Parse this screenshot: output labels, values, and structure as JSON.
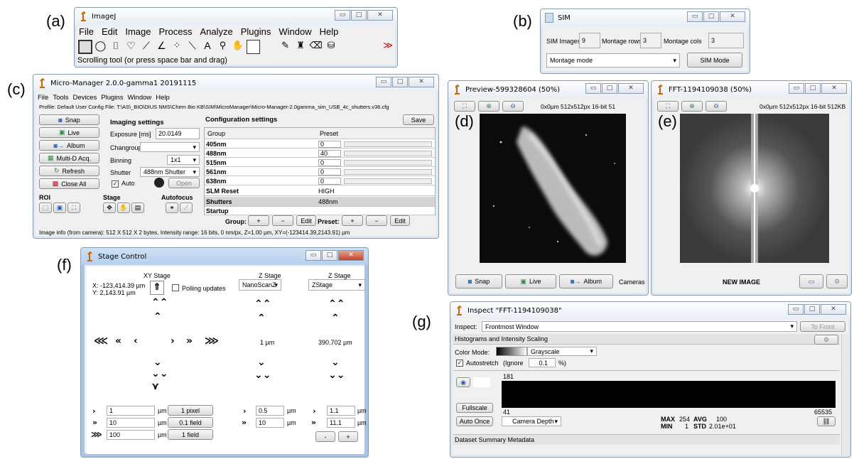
{
  "panels": {
    "a": "(a)",
    "b": "(b)",
    "c": "(c)",
    "d": "(d)",
    "e": "(e)",
    "f": "(f)",
    "g": "(g)"
  },
  "imagej": {
    "title": "ImageJ",
    "menu": [
      "File",
      "Edit",
      "Image",
      "Process",
      "Analyze",
      "Plugins",
      "Window",
      "Help"
    ],
    "status": "Scrolling tool (or press space bar and drag)",
    "more": "≫"
  },
  "sim": {
    "title": "SIM",
    "images_label": "SIM Images",
    "images_value": "9",
    "rows_label": "Montage rows",
    "rows_value": "3",
    "cols_label": "Montage cols",
    "cols_value": "3",
    "mode_value": "Montage mode",
    "mode_button": "SIM Mode"
  },
  "mm": {
    "title": "Micro-Manager 2.0.0-gamma1 20191115",
    "menu": [
      "File",
      "Tools",
      "Devices",
      "Plugins",
      "Window",
      "Help"
    ],
    "profile": "Profile: Default User Config File: T:\\AS\\_BIO\\DIUS NMS\\Chem Bio KB\\SIM\\MicroManager\\Micro-Manager-2.0gamma_sim_USB_4c_shutters.v36.cfg",
    "buttons": [
      "Snap",
      "Live",
      "Album",
      "Multi-D Acq.",
      "Refresh",
      "Close All"
    ],
    "imaging_title": "Imaging settings",
    "exposure_label": "Exposure [ms]",
    "exposure_value": "20.0149",
    "changroup_label": "Changroup",
    "binning_label": "Binning",
    "binning_value": "1x1",
    "shutter_label": "Shutter",
    "shutter_value": "488nm Shutter",
    "auto_label": "Auto",
    "open_label": "Open",
    "roi_label": "ROI",
    "stage_label": "Stage",
    "autofocus_label": "Autofocus",
    "config_title": "Configuration settings",
    "save_label": "Save",
    "col_group": "Group",
    "col_preset": "Preset",
    "rows": [
      {
        "group": "405nm",
        "value": "0"
      },
      {
        "group": "488nm",
        "value": "40"
      },
      {
        "group": "515nm",
        "value": "0"
      },
      {
        "group": "561nm",
        "value": "0"
      },
      {
        "group": "638nm",
        "value": "0"
      }
    ],
    "text_rows": [
      {
        "group": "SLM Reset",
        "value": "HIGH"
      },
      {
        "group": "Shutters",
        "value": "488nm"
      },
      {
        "group": "Startup",
        "value": ""
      }
    ],
    "group_label": "Group:",
    "preset_label": "Preset:",
    "plus": "+",
    "minus": "−",
    "edit": "Edit",
    "info": "Image info (from camera): 512 X 512 X 2 bytes, Intensity range: 16 bits, 0 nm/px, Z=1.00 µm, XY=(-123414.39,2143.91) µm"
  },
  "preview": {
    "title": "Preview-599328604 (50%)",
    "info": "0x0µm  512x512px  16-bit 51",
    "snap": "Snap",
    "live": "Live",
    "album": "Album",
    "cameras": "Cameras"
  },
  "fft": {
    "title": "FFT-1194109038 (50%)",
    "info": "0x0µm  512x512px  16-bit 512KB",
    "new_image": "NEW IMAGE"
  },
  "stage": {
    "title": "Stage Control",
    "xy_title": "XY Stage",
    "x_pos": "X: -123,414.39 µm",
    "y_pos": "Y: 2,143.91 µm",
    "polling": "Polling updates",
    "z1_title": "Z Stage",
    "z1_device": "NanoScanZ",
    "z1_pos": "1 µm",
    "z2_title": "Z Stage",
    "z2_device": "ZStage",
    "z2_pos": "390.702 µm",
    "xy_steps": [
      {
        "value": "1",
        "unit": "µm",
        "button": "1 pixel"
      },
      {
        "value": "10",
        "unit": "µm",
        "button": "0.1 field"
      },
      {
        "value": "100",
        "unit": "µm",
        "button": "1 field"
      }
    ],
    "z1_steps": [
      {
        "value": "0.5",
        "unit": "µm"
      },
      {
        "value": "10",
        "unit": "µm"
      }
    ],
    "z2_steps": [
      {
        "value": "1.1",
        "unit": "µm"
      },
      {
        "value": "11.1",
        "unit": "µm"
      }
    ],
    "minus": "-",
    "plus": "+"
  },
  "inspect": {
    "title": "Inspect \"FFT-1194109038\"",
    "inspect_label": "Inspect:",
    "inspect_value": "Frontmost Window",
    "to_front": "To Front",
    "section_hist": "Histograms and Intensity Scaling",
    "color_mode_label": "Color Mode:",
    "color_mode_value": "Grayscale",
    "autostretch": "Autostretch",
    "ignore_label": "(Ignore",
    "ignore_value": "0.1",
    "ignore_unit": "%)",
    "hist_max_marker": "181",
    "hist_min_marker": "41",
    "hist_end": "65535",
    "fullscale": "Fullscale",
    "auto_once": "Auto Once",
    "camera_depth": "Camera Depth",
    "max_label": "MAX",
    "max_value": "254",
    "avg_label": "AVG",
    "avg_value": "100",
    "min_label": "MIN",
    "min_value": "1",
    "std_label": "STD",
    "std_value": "2.01e+01",
    "section_meta": "Dataset Summary Metadata"
  }
}
